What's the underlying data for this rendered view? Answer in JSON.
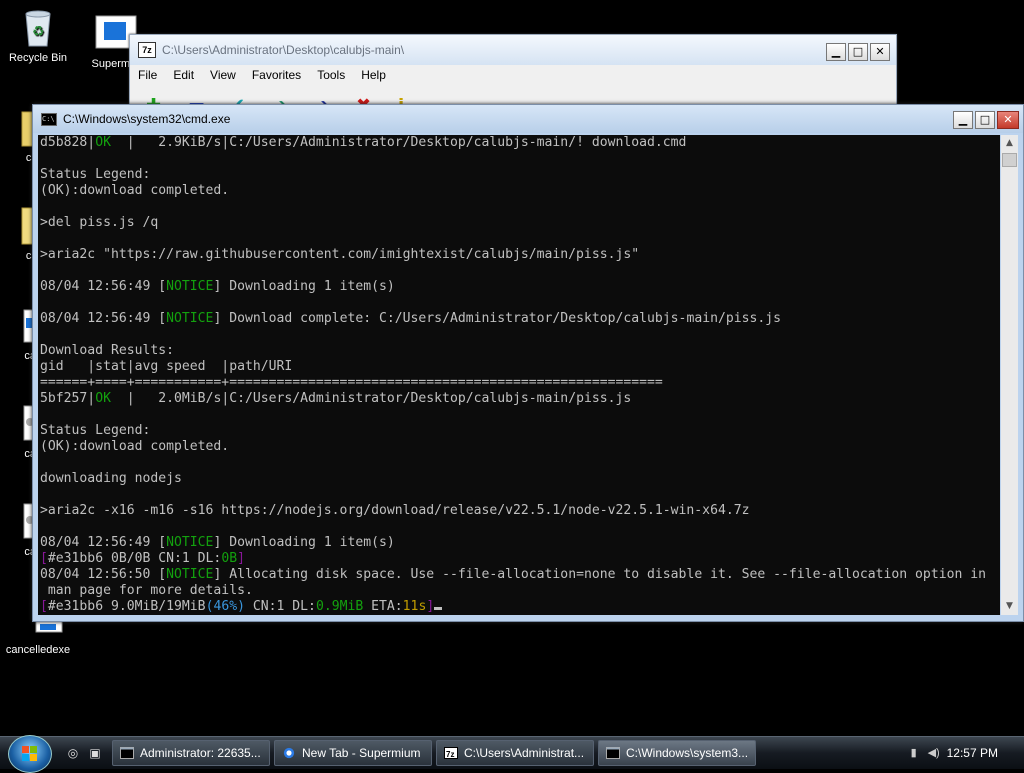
{
  "desktop": {
    "icons": [
      {
        "label": "Recycle Bin",
        "icon": "recycle-bin-icon"
      },
      {
        "label": "Supermi",
        "icon": "supermium-icon"
      },
      {
        "label": "calub",
        "icon": "folder-icon"
      },
      {
        "label": "calub",
        "icon": "folder-icon"
      },
      {
        "label": "cance",
        "icon": "file-icon"
      },
      {
        "label": "cance",
        "icon": "gear-file-icon"
      },
      {
        "label": "cance",
        "icon": "gear-file-icon"
      },
      {
        "label": "cancelledexe",
        "icon": "exe-file-icon"
      }
    ]
  },
  "zip_window": {
    "icon_text": "7z",
    "title": "C:\\Users\\Administrator\\Desktop\\calubjs-main\\",
    "menu": [
      "File",
      "Edit",
      "View",
      "Favorites",
      "Tools",
      "Help"
    ],
    "toolbar": [
      {
        "name": "add-icon",
        "glyph": "✚",
        "color": "#1ea51e"
      },
      {
        "name": "extract-icon",
        "glyph": "▬",
        "color": "#1c3fc9"
      },
      {
        "name": "test-icon",
        "glyph": "✔",
        "color": "#17a9b5"
      },
      {
        "name": "copy-icon",
        "glyph": "➔",
        "color": "#16986a"
      },
      {
        "name": "move-icon",
        "glyph": "➔",
        "color": "#1a2ea0"
      },
      {
        "name": "delete-icon",
        "glyph": "✖",
        "color": "#d01818"
      },
      {
        "name": "info-icon",
        "glyph": "i",
        "color": "#c9a400"
      }
    ]
  },
  "cmd_window": {
    "title": "C:\\Windows\\system32\\cmd.exe",
    "lines": [
      [
        {
          "t": "d5b828|"
        },
        {
          "t": "OK",
          "c": "g"
        },
        {
          "t": "  |   2.9KiB/s|C:/Users/Administrator/Desktop/calubjs-main/! download.cmd"
        }
      ],
      [
        {
          "t": ""
        }
      ],
      [
        {
          "t": "Status Legend:"
        }
      ],
      [
        {
          "t": "(OK):download completed."
        }
      ],
      [
        {
          "t": ""
        }
      ],
      [
        {
          "t": ">del piss.js /q"
        }
      ],
      [
        {
          "t": ""
        }
      ],
      [
        {
          "t": ">aria2c \"https://raw.githubusercontent.com/imightexist/calubjs/main/piss.js\""
        }
      ],
      [
        {
          "t": ""
        }
      ],
      [
        {
          "t": "08/04 12:56:49 ["
        },
        {
          "t": "NOTICE",
          "c": "g"
        },
        {
          "t": "] Downloading 1 item(s)"
        }
      ],
      [
        {
          "t": ""
        }
      ],
      [
        {
          "t": "08/04 12:56:49 ["
        },
        {
          "t": "NOTICE",
          "c": "g"
        },
        {
          "t": "] Download complete: C:/Users/Administrator/Desktop/calubjs-main/piss.js"
        }
      ],
      [
        {
          "t": ""
        }
      ],
      [
        {
          "t": "Download Results:"
        }
      ],
      [
        {
          "t": "gid   |stat|avg speed  |path/URI"
        }
      ],
      [
        {
          "t": "======+====+===========+======================================================="
        }
      ],
      [
        {
          "t": "5bf257|"
        },
        {
          "t": "OK",
          "c": "g"
        },
        {
          "t": "  |   2.0MiB/s|C:/Users/Administrator/Desktop/calubjs-main/piss.js"
        }
      ],
      [
        {
          "t": ""
        }
      ],
      [
        {
          "t": "Status Legend:"
        }
      ],
      [
        {
          "t": "(OK):download completed."
        }
      ],
      [
        {
          "t": ""
        }
      ],
      [
        {
          "t": "downloading nodejs"
        }
      ],
      [
        {
          "t": ""
        }
      ],
      [
        {
          "t": ">aria2c -x16 -m16 -s16 https://nodejs.org/download/release/v22.5.1/node-v22.5.1-win-x64.7z"
        }
      ],
      [
        {
          "t": ""
        }
      ],
      [
        {
          "t": "08/04 12:56:49 ["
        },
        {
          "t": "NOTICE",
          "c": "g"
        },
        {
          "t": "] Downloading 1 item(s)"
        }
      ],
      [
        {
          "t": "[",
          "c": "p"
        },
        {
          "t": "#e31bb6 0B/0B CN:1 DL:"
        },
        {
          "t": "0B",
          "c": "g"
        },
        {
          "t": "]",
          "c": "p"
        }
      ],
      [
        {
          "t": "08/04 12:56:50 ["
        },
        {
          "t": "NOTICE",
          "c": "g"
        },
        {
          "t": "] Allocating disk space. Use --file-allocation=none to disable it. See --file-allocation option in"
        }
      ],
      [
        {
          "t": " man page for more details."
        }
      ],
      [
        {
          "t": "[",
          "c": "p"
        },
        {
          "t": "#e31bb6 9.0MiB/19MiB"
        },
        {
          "t": "(46%)",
          "c": "c"
        },
        {
          "t": " CN:1 DL:"
        },
        {
          "t": "0.9MiB",
          "c": "g"
        },
        {
          "t": " ETA:"
        },
        {
          "t": "11s",
          "c": "y"
        },
        {
          "t": "]",
          "c": "p"
        },
        {
          "cursor": true
        }
      ]
    ]
  },
  "taskbar": {
    "tasks": [
      {
        "label": "Administrator:  22635...",
        "icon": "cmd-icon"
      },
      {
        "label": "New Tab - Supermium",
        "icon": "browser-icon"
      },
      {
        "label": "C:\\Users\\Administrat...",
        "icon": "7zip-icon"
      },
      {
        "label": "C:\\Windows\\system3...",
        "icon": "cmd-icon"
      }
    ],
    "clock": "12:57 PM"
  }
}
